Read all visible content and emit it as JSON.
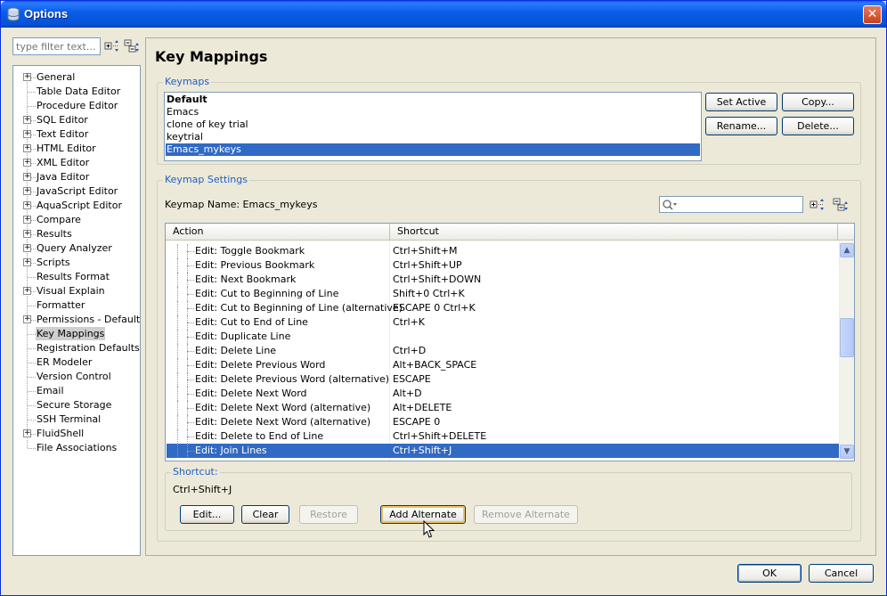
{
  "window": {
    "title": "Options"
  },
  "filter": {
    "placeholder": "type filter text..."
  },
  "tree": [
    {
      "label": "General",
      "expandable": true
    },
    {
      "label": "Table Data Editor",
      "expandable": false
    },
    {
      "label": "Procedure Editor",
      "expandable": false
    },
    {
      "label": "SQL Editor",
      "expandable": true
    },
    {
      "label": "Text Editor",
      "expandable": true
    },
    {
      "label": "HTML Editor",
      "expandable": true
    },
    {
      "label": "XML Editor",
      "expandable": true
    },
    {
      "label": "Java Editor",
      "expandable": true
    },
    {
      "label": "JavaScript Editor",
      "expandable": true
    },
    {
      "label": "AquaScript Editor",
      "expandable": true
    },
    {
      "label": "Compare",
      "expandable": true
    },
    {
      "label": "Results",
      "expandable": true
    },
    {
      "label": "Query Analyzer",
      "expandable": true
    },
    {
      "label": "Scripts",
      "expandable": true
    },
    {
      "label": "Results Format",
      "expandable": false
    },
    {
      "label": "Visual Explain",
      "expandable": true
    },
    {
      "label": "Formatter",
      "expandable": false
    },
    {
      "label": "Permissions - Default",
      "expandable": true
    },
    {
      "label": "Key Mappings",
      "expandable": false,
      "selected": true
    },
    {
      "label": "Registration Defaults",
      "expandable": false
    },
    {
      "label": "ER Modeler",
      "expandable": false
    },
    {
      "label": "Version Control",
      "expandable": false
    },
    {
      "label": "Email",
      "expandable": false
    },
    {
      "label": "Secure Storage",
      "expandable": false
    },
    {
      "label": "SSH Terminal",
      "expandable": false
    },
    {
      "label": "FluidShell",
      "expandable": true
    },
    {
      "label": "File Associations",
      "expandable": false
    }
  ],
  "page": {
    "title": "Key Mappings"
  },
  "keymaps": {
    "group_title": "Keymaps",
    "items": [
      "Default",
      "Emacs",
      "clone of key trial",
      "keytrial",
      "Emacs_mykeys"
    ],
    "selected_index": 4,
    "set_active_label": "Set Active",
    "copy_label": "Copy...",
    "rename_label": "Rename...",
    "delete_label": "Delete..."
  },
  "settings": {
    "group_title": "Keymap Settings",
    "keymap_name_label": "Keymap Name: Emacs_mykeys",
    "columns": [
      "Action",
      "Shortcut"
    ],
    "rows": [
      {
        "action": "Edit: Toggle Bookmark",
        "shortcut": "Ctrl+Shift+M"
      },
      {
        "action": "Edit: Previous Bookmark",
        "shortcut": "Ctrl+Shift+UP"
      },
      {
        "action": "Edit: Next Bookmark",
        "shortcut": "Ctrl+Shift+DOWN"
      },
      {
        "action": "Edit: Cut to Beginning of Line",
        "shortcut": "Shift+0 Ctrl+K"
      },
      {
        "action": "Edit: Cut to Beginning of Line (alternative)",
        "shortcut": "ESCAPE 0 Ctrl+K"
      },
      {
        "action": "Edit: Cut to End of Line",
        "shortcut": "Ctrl+K"
      },
      {
        "action": "Edit: Duplicate Line",
        "shortcut": ""
      },
      {
        "action": "Edit: Delete Line",
        "shortcut": "Ctrl+D"
      },
      {
        "action": "Edit: Delete Previous Word",
        "shortcut": "Alt+BACK_SPACE"
      },
      {
        "action": "Edit: Delete Previous Word (alternative)",
        "shortcut": "ESCAPE"
      },
      {
        "action": "Edit: Delete Next Word",
        "shortcut": "Alt+D"
      },
      {
        "action": "Edit: Delete Next Word (alternative)",
        "shortcut": "Alt+DELETE"
      },
      {
        "action": "Edit: Delete Next Word (alternative)",
        "shortcut": "ESCAPE 0"
      },
      {
        "action": "Edit: Delete to End of Line",
        "shortcut": "Ctrl+Shift+DELETE"
      },
      {
        "action": "Edit: Join Lines",
        "shortcut": "Ctrl+Shift+J"
      }
    ],
    "selected_index": 14
  },
  "shortcut": {
    "group_title": "Shortcut:",
    "value": "Ctrl+Shift+J",
    "edit_label": "Edit...",
    "clear_label": "Clear",
    "restore_label": "Restore",
    "add_alternate_label": "Add Alternate",
    "remove_alternate_label": "Remove Alternate"
  },
  "footer": {
    "ok_label": "OK",
    "cancel_label": "Cancel"
  }
}
